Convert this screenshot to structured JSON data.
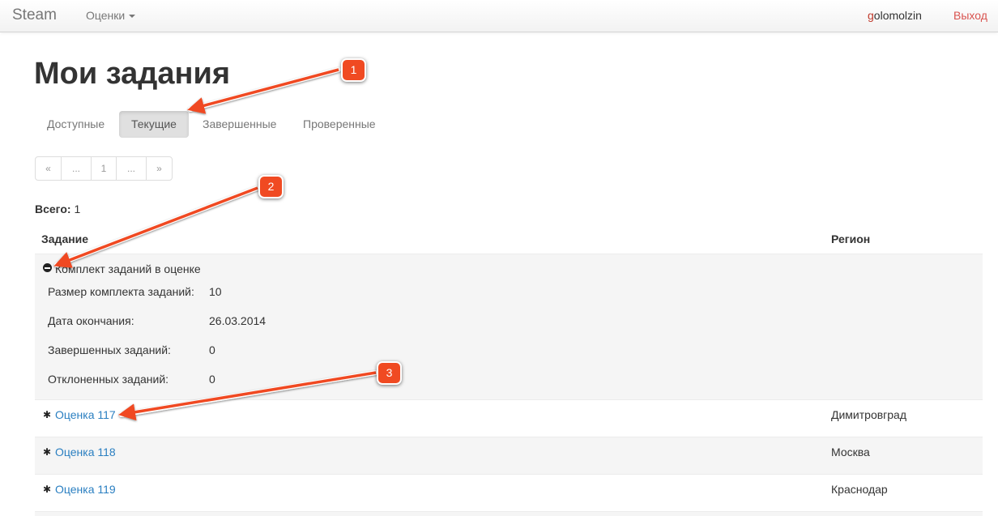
{
  "navbar": {
    "brand": "Steam",
    "menu_label": "Оценки",
    "user_first": "g",
    "user_rest": "olomolzin",
    "logout": "Выход"
  },
  "page_title": "Мои задания",
  "tabs": [
    {
      "label": "Доступные",
      "active": false
    },
    {
      "label": "Текущие",
      "active": true
    },
    {
      "label": "Завершенные",
      "active": false
    },
    {
      "label": "Проверенные",
      "active": false
    }
  ],
  "pagination": [
    "«",
    "...",
    "1",
    "...",
    "»"
  ],
  "total": {
    "label": "Всего:",
    "value": "1"
  },
  "table": {
    "headers": {
      "task": "Задание",
      "region": "Регион"
    },
    "set": {
      "title": "Комплект заданий в оценке",
      "details": [
        {
          "label": "Размер комплекта заданий:",
          "value": "10"
        },
        {
          "label": "Дата окончания:",
          "value": "26.03.2014"
        },
        {
          "label": "Завершенных заданий:",
          "value": "0"
        },
        {
          "label": "Отклоненных заданий:",
          "value": "0"
        }
      ]
    },
    "rows": [
      {
        "task": "Оценка 117",
        "region": "Димитровград"
      },
      {
        "task": "Оценка 118",
        "region": "Москва"
      },
      {
        "task": "Оценка 119",
        "region": "Краснодар"
      }
    ]
  },
  "annotations": [
    {
      "number": "1"
    },
    {
      "number": "2"
    },
    {
      "number": "3"
    }
  ],
  "colors": {
    "link": "#2a7fc1",
    "logout": "#d9534f",
    "annotation": "#f04a22"
  }
}
